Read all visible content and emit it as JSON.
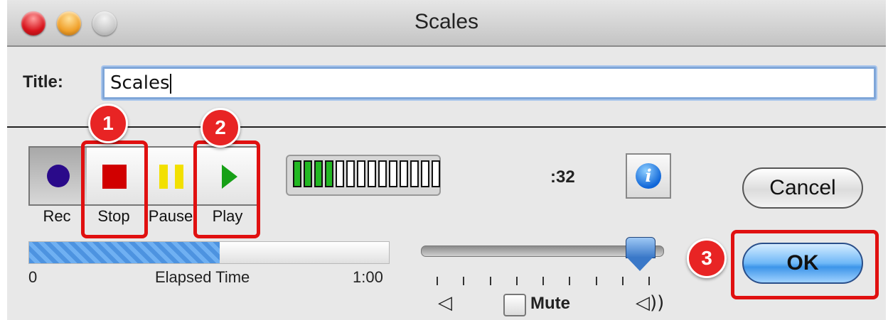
{
  "window": {
    "title": "Scales"
  },
  "form": {
    "title_label": "Title:",
    "title_value": "Scales"
  },
  "transport": {
    "rec": "Rec",
    "stop": "Stop",
    "pause": "Pause",
    "play": "Play"
  },
  "meter": {
    "segments_total": 14,
    "segments_lit": 4
  },
  "time_display": ":32",
  "buttons": {
    "cancel": "Cancel",
    "ok": "OK"
  },
  "elapsed": {
    "start": "0",
    "label": "Elapsed Time",
    "end": "1:00",
    "progress_fraction": 0.53
  },
  "volume": {
    "mute_label": "Mute",
    "level_fraction": 0.96,
    "tick_count": 9
  },
  "annotations": {
    "badge_1": "1",
    "badge_2": "2",
    "badge_3": "3"
  },
  "colors": {
    "callout": "#e01010",
    "meter_on": "#22b822",
    "accent": "#3d95e9"
  }
}
